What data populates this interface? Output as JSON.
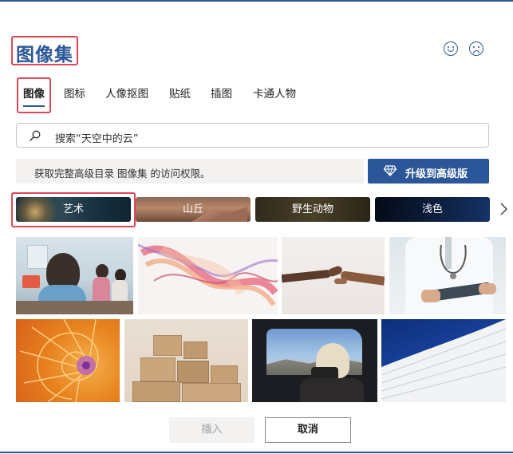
{
  "dialog": {
    "title": "图像集",
    "feedback": {
      "happy_icon": "smile-icon",
      "sad_icon": "frown-icon"
    }
  },
  "tabs": [
    {
      "label": "图像",
      "active": true
    },
    {
      "label": "图标",
      "active": false
    },
    {
      "label": "人像抠图",
      "active": false
    },
    {
      "label": "贴纸",
      "active": false
    },
    {
      "label": "插图",
      "active": false
    },
    {
      "label": "卡通人物",
      "active": false
    }
  ],
  "search": {
    "placeholder": "搜索“天空中的云”",
    "icon": "search-icon"
  },
  "promo": {
    "text": "获取完整高级目录 图像集 的访问权限。",
    "button_label": "升级到高级版",
    "button_icon": "diamond-icon"
  },
  "categories": [
    {
      "label": "艺术",
      "selected": true
    },
    {
      "label": "山丘",
      "selected": false
    },
    {
      "label": "野生动物",
      "selected": false
    },
    {
      "label": "浅色",
      "selected": false
    }
  ],
  "categories_next_icon": "chevron-right-icon",
  "images": [
    {
      "subject": "children-in-classroom"
    },
    {
      "subject": "abstract-colorful-swirl"
    },
    {
      "subject": "two-hands-reaching"
    },
    {
      "subject": "doctor-with-tablet"
    },
    {
      "subject": "orange-nautilus-shell"
    },
    {
      "subject": "stacked-cardboard-boxes"
    },
    {
      "subject": "photographer-in-car-window"
    },
    {
      "subject": "white-curved-architecture"
    }
  ],
  "footer": {
    "insert_label": "插入",
    "cancel_label": "取消"
  },
  "colors": {
    "accent": "#2b579a",
    "highlight": "#e0455a",
    "promo_bg": "#f3f2f1"
  }
}
